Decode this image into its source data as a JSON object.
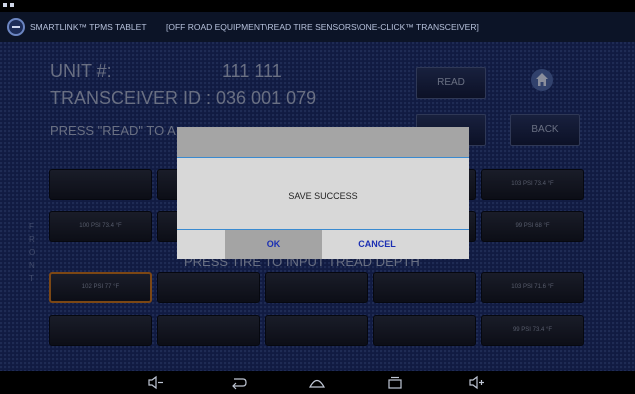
{
  "status_bar": {
    "icons": [
      "notification-icon",
      "notification-icon"
    ]
  },
  "titlebar": {
    "app_title": "SMARTLINK™ TPMS TABLET",
    "breadcrumb": "[OFF ROAD EQUIPMENT\\READ TIRE SENSORS\\ONE-CLICK™ TRANSCEIVER]"
  },
  "info": {
    "unit_label": "UNIT #:",
    "unit_value": "111 111",
    "transceiver": "TRANSCEIVER ID : 036 001 079",
    "instruction": "PRESS \"READ\" TO A",
    "instruction2": "PRESS TIRE TO INPUT TREAD DEPTH"
  },
  "buttons": {
    "read": "READ",
    "back": "BACK",
    "home_icon": "home-icon"
  },
  "front_label": [
    "F",
    "R",
    "O",
    "N",
    "T"
  ],
  "grid": {
    "rows": [
      [
        "",
        "",
        "",
        "",
        "103 PSI 73.4 °F"
      ],
      [
        "100 PSI 73.4 °F",
        "",
        "",
        "",
        "99 PSI 68 °F"
      ],
      [
        "102 PSI 77 °F",
        "",
        "",
        "",
        "103 PSI 71.6 °F"
      ],
      [
        "",
        "",
        "",
        "",
        "99 PSI 73.4 °F"
      ]
    ],
    "selected_cell": "row 3, column 1"
  },
  "dialog": {
    "message": "SAVE SUCCESS",
    "ok": "OK",
    "cancel": "CANCEL"
  },
  "nav_bar": {
    "icons": [
      "volume-down-icon",
      "back-icon",
      "home-icon",
      "recents-icon",
      "volume-up-icon"
    ]
  },
  "colors": {
    "background": "#1c2c64",
    "dialog_accent": "#3a8ad0",
    "dialog_button_text": "#1b2fb3",
    "selected_border": "#c9731a"
  }
}
